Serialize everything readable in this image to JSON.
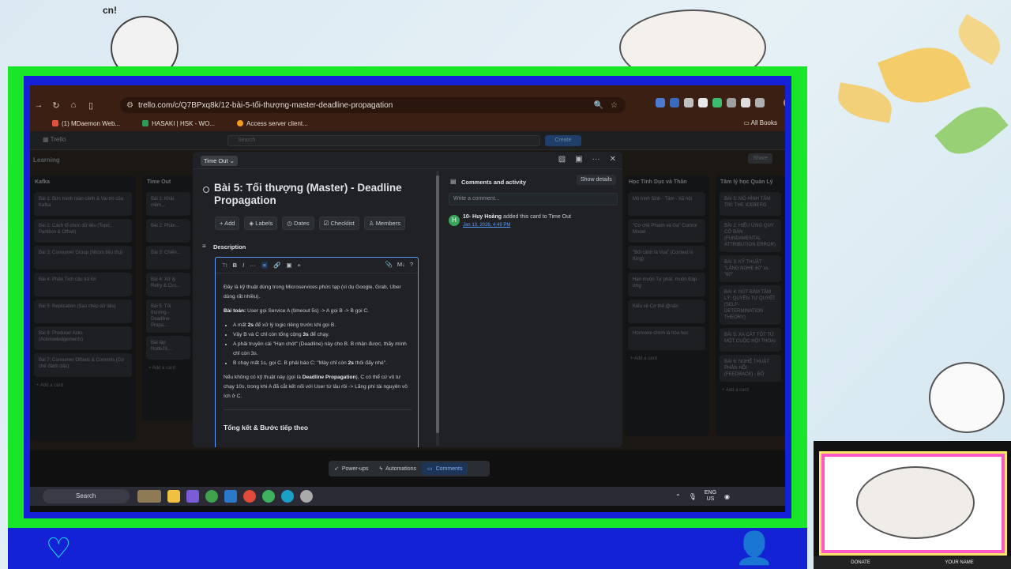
{
  "overlay": {
    "sticker_text": "cn!",
    "cam_labels": {
      "donate": "DONATE",
      "name": "YOUR NAME"
    }
  },
  "browser": {
    "url": "trello.com/c/Q7BPxq8k/12-bài-5-tối-thượng-master-deadline-propagation",
    "bookmarks": [
      {
        "label": "(1) MDaemon Web...",
        "color": "#e0523b"
      },
      {
        "label": "HASAKI | HSK - WO...",
        "color": "#2a9d5c"
      },
      {
        "label": "Access server client...",
        "color": "#f59c1a"
      }
    ],
    "all_bookmarks": "All Books",
    "nav_icons": [
      "back-icon",
      "forward-icon",
      "reload-icon",
      "home-icon",
      "sidebar-icon"
    ]
  },
  "board": {
    "search_placeholder": "Search",
    "create_label": "Create",
    "board_name": "Learning",
    "share_label": "Share",
    "app_name": "Trello",
    "columns": [
      {
        "title": "Kafka",
        "cards": [
          "Bài 1: Bức tranh toàn cảnh & Vai trò của Kafka",
          "Bài 2: Cách tổ chức dữ liệu (Topic, Partition & Offset)",
          "Bài 3: Consumer Group (Nhóm tiêu thụ)",
          "Bài 4: Phân Tích câu trả lời",
          "Bài 5: Replication (Sao chép dữ liệu)",
          "Bài 6: Producer Acks (Acknowledgements)",
          "Bài 7: Consumer Offsets & Commits (Cơ chế đánh dấu)"
        ],
        "add": "+ Add a card"
      },
      {
        "title": "Time Out",
        "cards": [
          "Bài 1: Khái niệm...",
          "Bài 2: Phân...",
          "Bài 3: Chiến...",
          "Bài 4: Xử lý Retry & Circ...",
          "Bài 5: Tối thượng - Deadline Propa...",
          "Bài tập NodeJS..."
        ],
        "add": "+ Add a card"
      },
      {
        "title": "Tâm lý học Quản Lý",
        "cards": [
          "BÀI 5: MÔ HÌNH TÂM TRÍ: THE ICEBERG",
          "BÀI 2: HIỆU ỨNG QUY CỞ BẢN (FUNDAMENTAL ATTRIBUTION ERROR)",
          "BÀI 3: KỸ THUẬT \"LẮNG NGHE 60\" vs. \"60\"",
          "BÀI 4: NÚT BẤM TÂM LÝ: QUYỀN TỰ QUYẾT (SELF-DETERMINATION THEORY)",
          "BÀI 5: XA CÁT TỐT TỪ MỘT CUỘC HỘI THOẠI",
          "BÀI 6: NGHỆ THUẬT PHẢN HỒI (FEEDBACK) - BỎ"
        ],
        "add": "+ Add a card"
      },
      {
        "title": "Học Tính Dục và Thân",
        "cards": [
          "Mô hình Sinh - Tâm - Xã hội",
          "\"Cơ chế Phanh và Ga\" Control Model",
          "\"Bối cảnh là Vua\" (Context is King)",
          "Hạn muộn Tự phát, muộn Đáp ứng",
          "Kiểu về Cơ thể @nấn",
          "Hormone chính là hóa học"
        ],
        "add": "+ Add a card"
      }
    ]
  },
  "modal": {
    "list_name": "Time Out",
    "card_title": "Bài 5: Tối thượng (Master) - Deadline Propagation",
    "actions": [
      "Add",
      "Labels",
      "Dates",
      "Checklist",
      "Members"
    ],
    "description_label": "Description",
    "toolbar": {
      "text_style": "Tt",
      "bold": "B",
      "italic": "I",
      "more": "···",
      "list": "≡",
      "link": "🔗",
      "image": "▣",
      "insert": "+",
      "attach": "📎",
      "markdown": "M↓",
      "help": "?"
    },
    "doc": {
      "intro": "Đây là kỹ thuật dùng trong Microservices phức tạp (ví dụ Google, Grab, Uber dùng rất nhiều).",
      "problem_label": "Bài toán:",
      "problem_text": " User gọi Service A (timeout 5s) -> A gọi B -> B gọi C.",
      "bullets": [
        [
          "A mất ",
          "2s",
          " để xử lý logic riêng trước khi gọi B.",
          ""
        ],
        [
          "Vậy B và C chỉ còn tổng cộng ",
          "3s",
          " để chạy.",
          ""
        ],
        [
          "A phải truyền cái \"Hạn chót\" (Deadline) này cho B. B nhận được, thấy mình chỉ còn 3s.",
          "",
          "",
          ""
        ],
        [
          "B chạy mất 1s, gọi C. B phải báo C: \"Mày chỉ còn ",
          "2s",
          " thôi đấy nhé\".",
          ""
        ]
      ],
      "conclusion_pre": "Nếu không có kỹ thuật này (gọi là ",
      "conclusion_bold": "Deadline Propagation",
      "conclusion_post": "), C có thể cứ vô tư chạy 10s, trong khi A đã cắt kết nối với User từ lâu rồi -> Lãng phí tài nguyên vô ích ở C.",
      "next_heading": "Tổng kết & Bước tiếp theo"
    },
    "comments": {
      "title": "Comments and activity",
      "show_details": "Show details",
      "placeholder": "Write a comment...",
      "activity_user": "10- Huy Hoàng",
      "activity_text": " added this card to Time Out",
      "activity_time": "Jan 13, 2026, 4:49 PM",
      "avatar_letter": "H"
    }
  },
  "bottom_nav": {
    "powerups": "Power-ups",
    "automations": "Automations",
    "comments": "Comments"
  },
  "taskbar": {
    "search": "Search",
    "lang_top": "ENG",
    "lang_bottom": "US"
  }
}
